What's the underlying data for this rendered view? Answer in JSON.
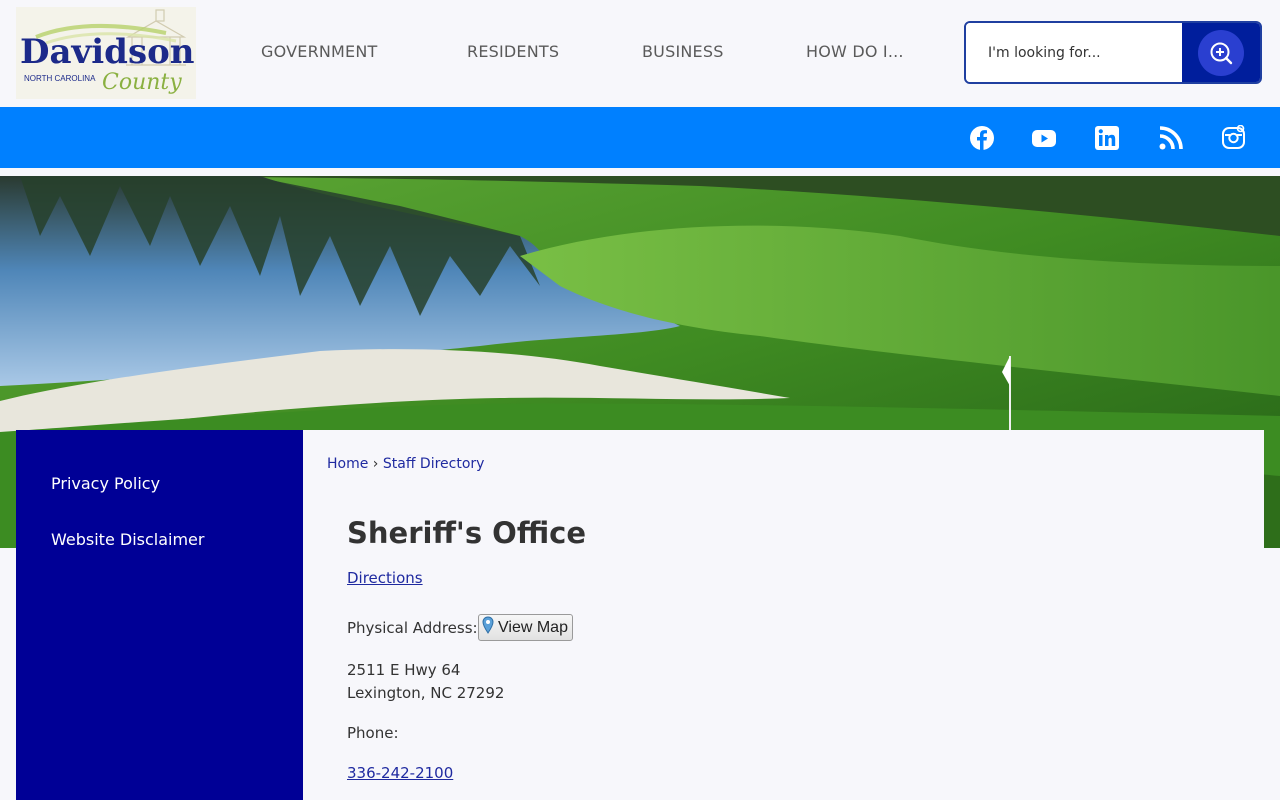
{
  "logo": {
    "name": "Davidson",
    "state": "NORTH CAROLINA",
    "county": "County"
  },
  "nav": {
    "items": [
      "GOVERNMENT",
      "RESIDENTS",
      "BUSINESS",
      "HOW DO I..."
    ]
  },
  "search": {
    "placeholder": "I'm looking for...",
    "button_icon": "search-plus-icon"
  },
  "social": {
    "icons": [
      "facebook-icon",
      "youtube-icon",
      "linkedin-icon",
      "rss-icon",
      "instagram-icon"
    ]
  },
  "sidebar": {
    "links": [
      "Privacy Policy",
      "Website Disclaimer"
    ]
  },
  "breadcrumb": {
    "home": "Home",
    "separator": "›",
    "current": "Staff Directory"
  },
  "page": {
    "title": "Sheriff's Office",
    "directions": "Directions",
    "physical_address_label": "Physical Address:",
    "view_map": "View Map",
    "address_line1": "2511 E Hwy 64",
    "address_line2": "Lexington, NC 27292",
    "phone_label": "Phone:",
    "phone": "336-242-2100"
  },
  "colors": {
    "primary": "#000096",
    "social_bar": "#0080ff",
    "link": "#1f2aa0",
    "search_button": "#001e9c"
  }
}
